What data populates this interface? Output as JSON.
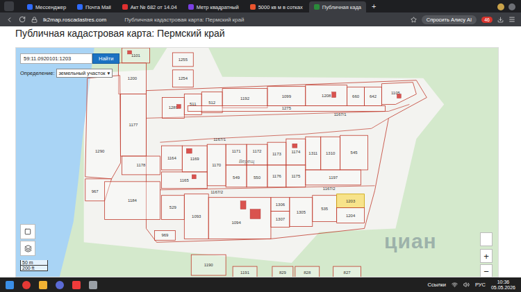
{
  "browser": {
    "tabs": [
      {
        "label": "Мессенджер",
        "selected": false,
        "color": "#2f6bff"
      },
      {
        "label": "Почта Mail",
        "selected": false,
        "color": "#2f6bff"
      },
      {
        "label": "Акт № 682 от 14.04",
        "selected": false,
        "color": "#e03030"
      },
      {
        "label": "Метр квадратный",
        "selected": false,
        "color": "#7b3fe4"
      },
      {
        "label": "5000 кв м в сотках",
        "selected": false,
        "color": "#e8542e"
      },
      {
        "label": "Публичная када",
        "selected": true,
        "color": "#2a8a3a"
      }
    ],
    "new_tab": "+",
    "address": {
      "url": "lk2map.roscadastres.com",
      "page_title": "Публичная кадастровая карта: Пермский край"
    },
    "alice": "Спросить Алису AI",
    "badge": "46"
  },
  "page": {
    "heading": "Публичная кадастровая карта: Пермский край"
  },
  "map": {
    "search": {
      "value": "59:11.0920101:1203",
      "button": "Найти"
    },
    "definition": {
      "label": "Определение:",
      "value": "земельный участок"
    },
    "parcels": [
      {
        "label": "1101",
        "selected": false
      },
      {
        "label": "1200",
        "selected": false
      },
      {
        "label": "1255",
        "selected": false
      },
      {
        "label": "1254",
        "selected": false
      },
      {
        "label": "1289",
        "selected": false
      },
      {
        "label": "511",
        "selected": false
      },
      {
        "label": "512",
        "selected": false
      },
      {
        "label": "1192",
        "selected": false
      },
      {
        "label": "1099",
        "selected": false
      },
      {
        "label": "1208",
        "selected": false
      },
      {
        "label": "660",
        "selected": false
      },
      {
        "label": "642",
        "selected": false
      },
      {
        "label": "1105",
        "selected": false
      },
      {
        "label": "1275",
        "selected": false
      },
      {
        "label": "1177",
        "selected": false
      },
      {
        "label": "1290",
        "selected": false
      },
      {
        "label": "1178",
        "selected": false
      },
      {
        "label": "1164",
        "selected": false
      },
      {
        "label": "1169",
        "selected": false
      },
      {
        "label": "1170",
        "selected": false
      },
      {
        "label": "1171",
        "selected": false
      },
      {
        "label": "1172",
        "selected": false
      },
      {
        "label": "1173",
        "selected": false
      },
      {
        "label": "1174",
        "selected": false
      },
      {
        "label": "1311",
        "selected": false
      },
      {
        "label": "1310",
        "selected": false
      },
      {
        "label": "545",
        "selected": false
      },
      {
        "label": "1165",
        "selected": false
      },
      {
        "label": "549",
        "selected": false
      },
      {
        "label": "550",
        "selected": false
      },
      {
        "label": "1176",
        "selected": false
      },
      {
        "label": "1175",
        "selected": false
      },
      {
        "label": "1197",
        "selected": false
      },
      {
        "label": "967",
        "selected": false
      },
      {
        "label": "1184",
        "selected": false
      },
      {
        "label": "529",
        "selected": false
      },
      {
        "label": "1093",
        "selected": false
      },
      {
        "label": "1094",
        "selected": false
      },
      {
        "label": "1306",
        "selected": false
      },
      {
        "label": "1307",
        "selected": false
      },
      {
        "label": "1305",
        "selected": false
      },
      {
        "label": "535",
        "selected": false
      },
      {
        "label": "1203",
        "selected": true
      },
      {
        "label": "1204",
        "selected": false
      },
      {
        "label": "969",
        "selected": false
      },
      {
        "label": "1190",
        "selected": false
      },
      {
        "label": "1191",
        "selected": false
      },
      {
        "label": "829",
        "selected": false
      },
      {
        "label": "828",
        "selected": false
      },
      {
        "label": "827",
        "selected": false
      }
    ],
    "roads": [
      {
        "label": "1167/1"
      },
      {
        "label": "1167/1"
      },
      {
        "label": "1167/2"
      },
      {
        "label": "1167/2"
      }
    ],
    "place": "Верещ",
    "scale": {
      "metric": "50 m",
      "imperial": "200 ft"
    },
    "zoom": {
      "in": "+",
      "out": "−"
    },
    "watermark": "циан"
  },
  "taskbar": {
    "links": "Ссылки",
    "language": "РУС",
    "time": "10:36",
    "date": "05.05.2026"
  }
}
